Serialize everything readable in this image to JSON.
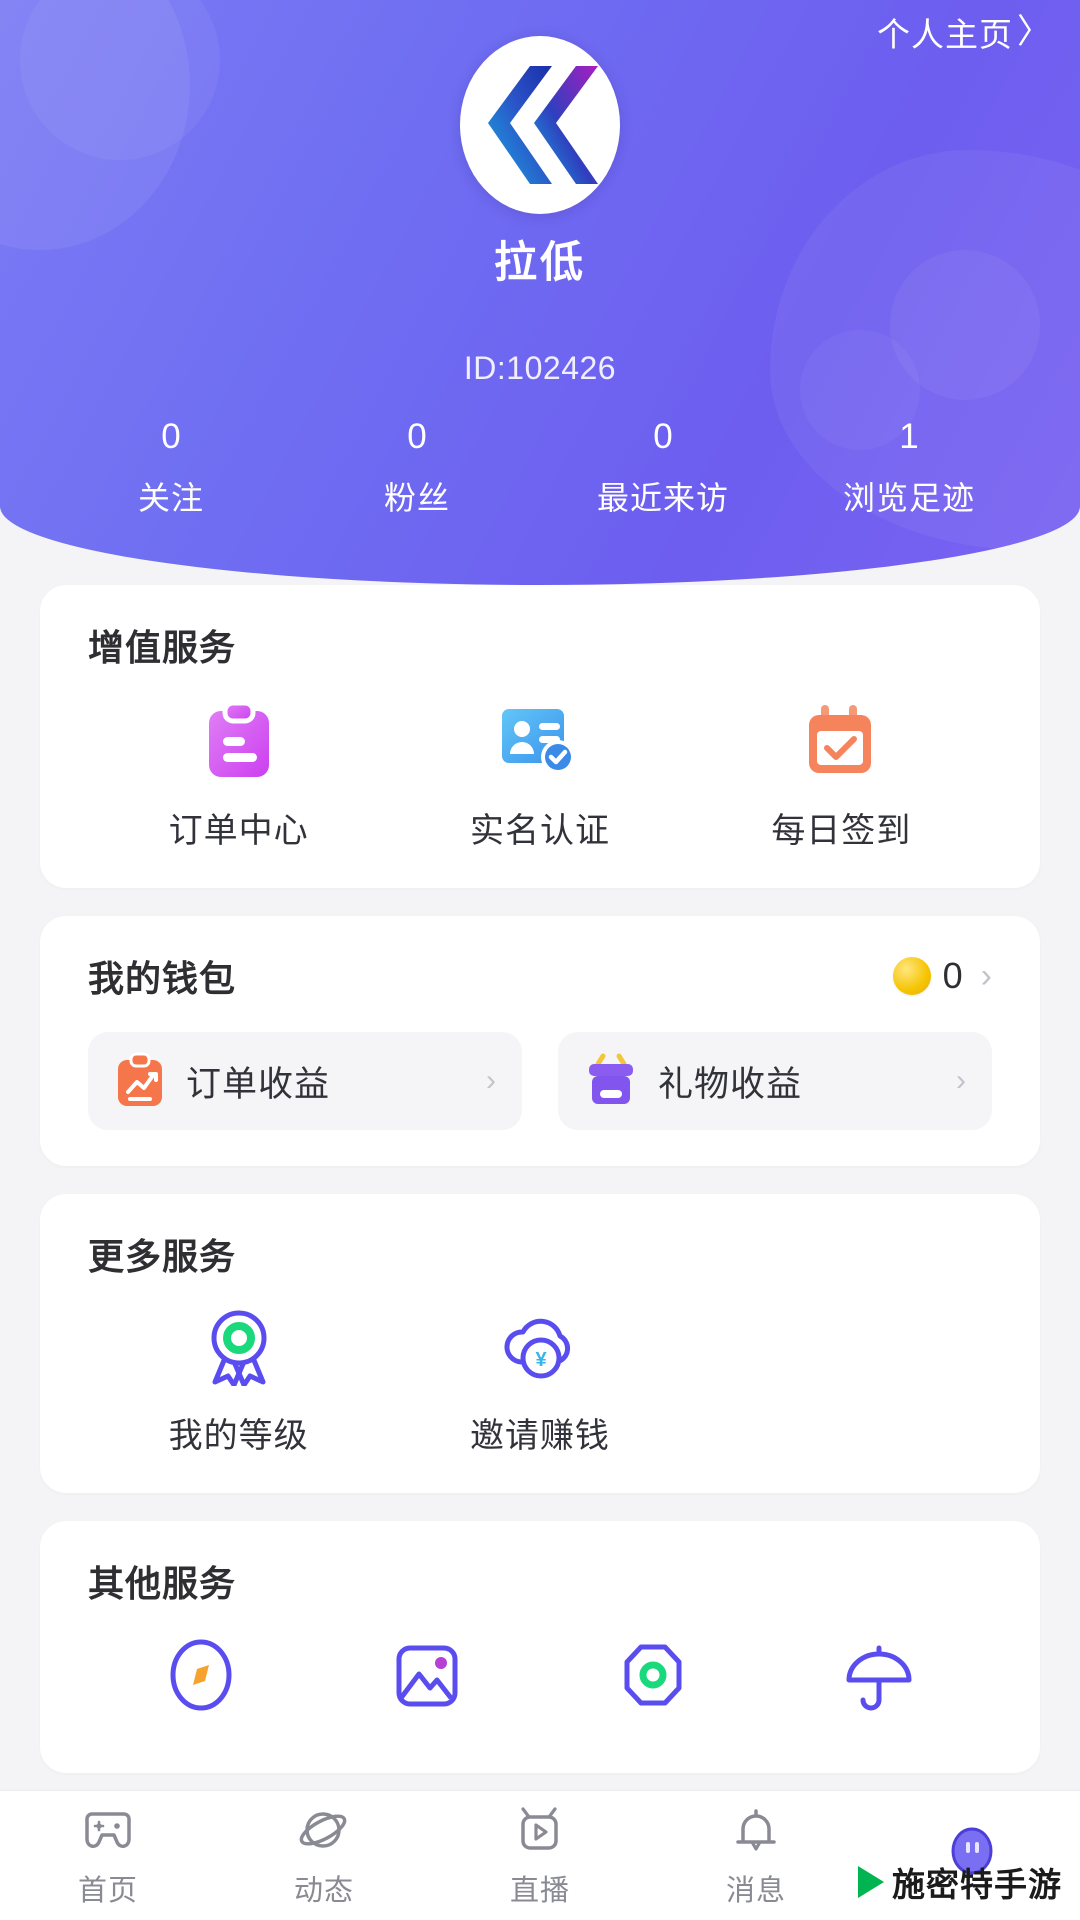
{
  "header": {
    "home_link": "个人主页",
    "home_link_chevron": "〉",
    "nickname": "拉低",
    "uid": "ID:102426",
    "avatar_icon": "kk-logo-icon",
    "stats": [
      {
        "value": "0",
        "label": "关注"
      },
      {
        "value": "0",
        "label": "粉丝"
      },
      {
        "value": "0",
        "label": "最近来访"
      },
      {
        "value": "1",
        "label": "浏览足迹"
      }
    ],
    "bg_color": "#6f6ef2"
  },
  "value_added": {
    "title": "增值服务",
    "items": [
      {
        "label": "订单中心",
        "icon": "clipboard-icon",
        "color": "#d65ef0"
      },
      {
        "label": "实名认证",
        "icon": "id-card-verified-icon",
        "color": "#4eaaf0"
      },
      {
        "label": "每日签到",
        "icon": "calendar-check-icon",
        "color": "#f59070"
      }
    ]
  },
  "wallet": {
    "title": "我的钱包",
    "coin_icon": "coin-icon",
    "coin_value": "0",
    "chevron": "›",
    "actions": [
      {
        "label": "订单收益",
        "icon": "order-income-icon",
        "color": "#f5764a",
        "chevron": "›"
      },
      {
        "label": "礼物收益",
        "icon": "gift-income-icon",
        "color": "#8a5cf0",
        "chevron": "›"
      }
    ]
  },
  "more_services": {
    "title": "更多服务",
    "items": [
      {
        "label": "我的等级",
        "icon": "medal-icon"
      },
      {
        "label": "邀请赚钱",
        "icon": "cloud-yuan-icon"
      }
    ]
  },
  "other_services": {
    "title": "其他服务",
    "items": [
      {
        "label": "",
        "icon": "compass-icon"
      },
      {
        "label": "",
        "icon": "image-icon"
      },
      {
        "label": "",
        "icon": "octagon-shield-icon"
      },
      {
        "label": "",
        "icon": "umbrella-icon"
      }
    ]
  },
  "tabbar": {
    "items": [
      {
        "label": "首页",
        "icon": "gamepad-icon",
        "active": false
      },
      {
        "label": "动态",
        "icon": "planet-icon",
        "active": false
      },
      {
        "label": "直播",
        "icon": "tv-play-icon",
        "active": false
      },
      {
        "label": "消息",
        "icon": "bell-icon",
        "active": false
      },
      {
        "label": "",
        "icon": "profile-avatar-icon",
        "active": true
      }
    ]
  },
  "watermark": {
    "text": "施密特手游",
    "icon": "play-triangle-icon"
  },
  "colors": {
    "accent": "#6358f0",
    "header": "#6f6ef2",
    "coin": "#f5c400",
    "green": "#19d97c"
  }
}
